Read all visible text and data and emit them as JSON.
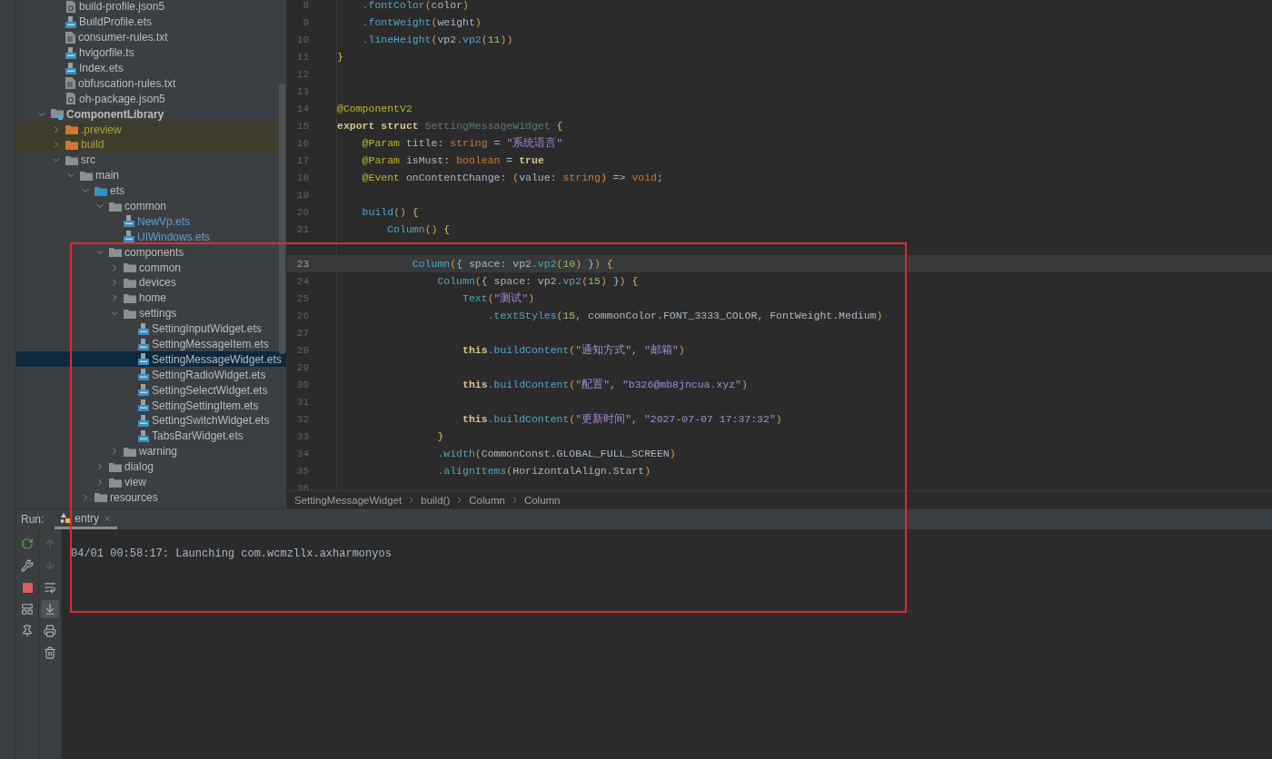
{
  "tree": [
    {
      "children": [
        {
          "name": "build-profile.json5",
          "kind": "json5",
          "selected": false,
          "excluded": false,
          "changed": false
        },
        {
          "name": "BuildProfile.ets",
          "kind": "ets",
          "selected": false,
          "excluded": false,
          "changed": false
        },
        {
          "name": "consumer-rules.txt",
          "kind": "txt",
          "selected": false,
          "excluded": false,
          "changed": false
        },
        {
          "name": "hvigorfile.ts",
          "kind": "ets",
          "selected": false,
          "excluded": false,
          "changed": false
        },
        {
          "name": "Index.ets",
          "kind": "ets",
          "selected": false,
          "excluded": false,
          "changed": false
        },
        {
          "name": "obfuscation-rules.txt",
          "kind": "txt",
          "selected": false,
          "excluded": false,
          "changed": false
        },
        {
          "name": "oh-package.json5",
          "kind": "json5",
          "selected": false,
          "excluded": false,
          "changed": false
        }
      ]
    },
    {
      "name": "ComponentLibrary",
      "kind": "module",
      "expanded": true,
      "selected": false,
      "excluded": false,
      "changed": false,
      "children": [
        {
          "name": ".preview",
          "kind": "folder",
          "expanded": false,
          "selected": false,
          "excluded": true,
          "changed": false
        },
        {
          "name": "build",
          "kind": "folder",
          "expanded": false,
          "selected": false,
          "excluded": true,
          "changed": false
        },
        {
          "name": "src",
          "kind": "folder",
          "expanded": true,
          "selected": false,
          "excluded": false,
          "changed": false,
          "children": [
            {
              "name": "main",
              "kind": "folder",
              "expanded": true,
              "selected": false,
              "excluded": false,
              "changed": false,
              "children": [
                {
                  "name": "ets",
                  "kind": "source",
                  "expanded": true,
                  "selected": false,
                  "excluded": false,
                  "changed": false,
                  "children": [
                    {
                      "name": "common",
                      "kind": "folder",
                      "expanded": true,
                      "selected": false,
                      "excluded": false,
                      "changed": false,
                      "children": [
                        {
                          "name": "NewVp.ets",
                          "kind": "ets",
                          "selected": false,
                          "excluded": false,
                          "changed": true
                        },
                        {
                          "name": "UIWindows.ets",
                          "kind": "ets",
                          "selected": false,
                          "excluded": false,
                          "changed": true
                        }
                      ]
                    },
                    {
                      "name": "components",
                      "kind": "folder",
                      "expanded": true,
                      "selected": false,
                      "excluded": false,
                      "changed": false,
                      "children": [
                        {
                          "name": "common",
                          "kind": "folder",
                          "expanded": false,
                          "selected": false,
                          "excluded": false,
                          "changed": false
                        },
                        {
                          "name": "devices",
                          "kind": "folder",
                          "expanded": false,
                          "selected": false,
                          "excluded": false,
                          "changed": false
                        },
                        {
                          "name": "home",
                          "kind": "folder",
                          "expanded": false,
                          "selected": false,
                          "excluded": false,
                          "changed": false
                        },
                        {
                          "name": "settings",
                          "kind": "folder",
                          "expanded": true,
                          "selected": false,
                          "excluded": false,
                          "changed": false,
                          "children": [
                            {
                              "name": "SettingInputWidget.ets",
                              "kind": "ets",
                              "selected": false,
                              "excluded": false,
                              "changed": false
                            },
                            {
                              "name": "SettingMessageItem.ets",
                              "kind": "ets",
                              "selected": false,
                              "excluded": false,
                              "changed": false
                            },
                            {
                              "name": "SettingMessageWidget.ets",
                              "kind": "ets",
                              "selected": true,
                              "excluded": false,
                              "changed": false
                            },
                            {
                              "name": "SettingRadioWidget.ets",
                              "kind": "ets",
                              "selected": false,
                              "excluded": false,
                              "changed": false
                            },
                            {
                              "name": "SettingSelectWidget.ets",
                              "kind": "ets",
                              "selected": false,
                              "excluded": false,
                              "changed": false
                            },
                            {
                              "name": "SettingSettingItem.ets",
                              "kind": "ets",
                              "selected": false,
                              "excluded": false,
                              "changed": false
                            },
                            {
                              "name": "SettingSwitchWidget.ets",
                              "kind": "ets",
                              "selected": false,
                              "excluded": false,
                              "changed": false
                            },
                            {
                              "name": "TabsBarWidget.ets",
                              "kind": "ets",
                              "selected": false,
                              "excluded": false,
                              "changed": false
                            }
                          ]
                        },
                        {
                          "name": "warning",
                          "kind": "folder",
                          "expanded": false,
                          "selected": false,
                          "excluded": false,
                          "changed": false
                        }
                      ]
                    },
                    {
                      "name": "dialog",
                      "kind": "folder",
                      "expanded": false,
                      "selected": false,
                      "excluded": false,
                      "changed": false
                    },
                    {
                      "name": "view",
                      "kind": "folder",
                      "expanded": false,
                      "selected": false,
                      "excluded": false,
                      "changed": false
                    }
                  ]
                },
                {
                  "name": "resources",
                  "kind": "folder",
                  "expanded": false,
                  "selected": false,
                  "excluded": false,
                  "changed": false
                }
              ]
            }
          ]
        }
      ]
    }
  ],
  "editor": {
    "lines": [
      {
        "number": "8",
        "selected": false,
        "tokens": [
          {
            "kind": "method",
            "text": "    .fontColor"
          },
          {
            "kind": "paren",
            "text": "("
          },
          {
            "kind": "plain",
            "text": "color"
          },
          {
            "kind": "paren",
            "text": ")"
          }
        ]
      },
      {
        "number": "9",
        "selected": false,
        "tokens": [
          {
            "kind": "method",
            "text": "    .fontWeight"
          },
          {
            "kind": "paren",
            "text": "("
          },
          {
            "kind": "plain",
            "text": "weight"
          },
          {
            "kind": "paren",
            "text": ")"
          }
        ]
      },
      {
        "number": "10",
        "selected": false,
        "tokens": [
          {
            "kind": "method",
            "text": "    .lineHeight"
          },
          {
            "kind": "paren",
            "text": "("
          },
          {
            "kind": "plain",
            "text": "vp2"
          },
          {
            "kind": "method",
            "text": ".vp2"
          },
          {
            "kind": "paren",
            "text": "("
          },
          {
            "kind": "number",
            "text": "11"
          },
          {
            "kind": "paren",
            "text": "))"
          }
        ]
      },
      {
        "number": "11",
        "selected": false,
        "tokens": [
          {
            "kind": "brace",
            "text": "}"
          }
        ]
      },
      {
        "number": "12",
        "selected": false
      },
      {
        "number": "13",
        "selected": false
      },
      {
        "number": "14",
        "selected": false,
        "tokens": [
          {
            "kind": "annotation",
            "text": "@ComponentV2"
          }
        ]
      },
      {
        "number": "15",
        "selected": false,
        "tokens": [
          {
            "kind": "keyword",
            "text": "export struct "
          },
          {
            "kind": "unused",
            "text": "SettingMessageWidget"
          },
          {
            "kind": "brace",
            "text": " {"
          }
        ]
      },
      {
        "number": "16",
        "selected": false,
        "tokens": [
          {
            "kind": "annotation",
            "text": "    @Param"
          },
          {
            "kind": "plain",
            "text": " title: "
          },
          {
            "kind": "type",
            "text": "string"
          },
          {
            "kind": "plain",
            "text": " = "
          },
          {
            "kind": "string",
            "text": "\"系统语言\""
          }
        ]
      },
      {
        "number": "17",
        "selected": false,
        "tokens": [
          {
            "kind": "annotation",
            "text": "    @Param"
          },
          {
            "kind": "plain",
            "text": " isMust: "
          },
          {
            "kind": "type",
            "text": "boolean"
          },
          {
            "kind": "plain",
            "text": " = "
          },
          {
            "kind": "keyword",
            "text": "true"
          }
        ]
      },
      {
        "number": "18",
        "selected": false,
        "tokens": [
          {
            "kind": "annotation",
            "text": "    @Event"
          },
          {
            "kind": "plain",
            "text": " onContentChange: "
          },
          {
            "kind": "paren",
            "text": "("
          },
          {
            "kind": "plain",
            "text": "value: "
          },
          {
            "kind": "type",
            "text": "string"
          },
          {
            "kind": "paren",
            "text": ")"
          },
          {
            "kind": "plain",
            "text": " => "
          },
          {
            "kind": "type",
            "text": "void"
          },
          {
            "kind": "plain",
            "text": ";"
          }
        ]
      },
      {
        "number": "19",
        "selected": false
      },
      {
        "number": "20",
        "selected": false,
        "tokens": [
          {
            "kind": "method",
            "text": "    build"
          },
          {
            "kind": "paren",
            "text": "()"
          },
          {
            "kind": "brace",
            "text": " {"
          }
        ]
      },
      {
        "number": "21",
        "selected": false,
        "tokens": [
          {
            "kind": "method",
            "text": "        Column"
          },
          {
            "kind": "paren",
            "text": "()"
          },
          {
            "kind": "brace",
            "text": " {"
          }
        ]
      },
      {
        "selected": false
      },
      {
        "number": "23",
        "selected": true,
        "tokens": [
          {
            "kind": "method",
            "text": "            Column"
          },
          {
            "kind": "paren",
            "text": "("
          },
          {
            "kind": "plain",
            "text": "{ space: vp2"
          },
          {
            "kind": "method",
            "text": ".vp2"
          },
          {
            "kind": "paren",
            "text": "("
          },
          {
            "kind": "number",
            "text": "10"
          },
          {
            "kind": "paren",
            "text": ")"
          },
          {
            "kind": "plain",
            "text": " }"
          },
          {
            "kind": "paren",
            "text": ")"
          },
          {
            "kind": "brace",
            "text": " {"
          }
        ]
      },
      {
        "number": "24",
        "selected": false,
        "tokens": [
          {
            "kind": "method",
            "text": "                Column"
          },
          {
            "kind": "paren",
            "text": "("
          },
          {
            "kind": "plain",
            "text": "{ space: vp2"
          },
          {
            "kind": "method",
            "text": ".vp2"
          },
          {
            "kind": "paren",
            "text": "("
          },
          {
            "kind": "number",
            "text": "15"
          },
          {
            "kind": "paren",
            "text": ")"
          },
          {
            "kind": "plain",
            "text": " }"
          },
          {
            "kind": "paren",
            "text": ")"
          },
          {
            "kind": "brace",
            "text": " {"
          }
        ]
      },
      {
        "number": "25",
        "selected": false,
        "tokens": [
          {
            "kind": "method",
            "text": "                    Text"
          },
          {
            "kind": "paren",
            "text": "("
          },
          {
            "kind": "string",
            "text": "\"测试\""
          },
          {
            "kind": "paren",
            "text": ")"
          }
        ]
      },
      {
        "number": "26",
        "selected": false,
        "tokens": [
          {
            "kind": "method",
            "text": "                        .textStyles"
          },
          {
            "kind": "paren",
            "text": "("
          },
          {
            "kind": "number",
            "text": "15"
          },
          {
            "kind": "plain",
            "text": ", commonColor.FONT_3333_COLOR, FontWeight.Medium"
          },
          {
            "kind": "paren",
            "text": ")"
          }
        ]
      },
      {
        "number": "27",
        "selected": false
      },
      {
        "number": "28",
        "selected": false,
        "tokens": [
          {
            "kind": "keyword",
            "text": "                    this"
          },
          {
            "kind": "method",
            "text": ".buildContent"
          },
          {
            "kind": "paren",
            "text": "("
          },
          {
            "kind": "string",
            "text": "\"通知方式\""
          },
          {
            "kind": "plain",
            "text": ", "
          },
          {
            "kind": "string",
            "text": "\"邮箱\""
          },
          {
            "kind": "paren",
            "text": ")"
          }
        ]
      },
      {
        "number": "29",
        "selected": false
      },
      {
        "number": "30",
        "selected": false,
        "tokens": [
          {
            "kind": "keyword",
            "text": "                    this"
          },
          {
            "kind": "method",
            "text": ".buildContent"
          },
          {
            "kind": "paren",
            "text": "("
          },
          {
            "kind": "string",
            "text": "\"配置\""
          },
          {
            "kind": "plain",
            "text": ", "
          },
          {
            "kind": "string",
            "text": "\"b326@mb8jncua.xyz\""
          },
          {
            "kind": "paren",
            "text": ")"
          }
        ]
      },
      {
        "number": "31",
        "selected": false
      },
      {
        "number": "32",
        "selected": false,
        "tokens": [
          {
            "kind": "keyword",
            "text": "                    this"
          },
          {
            "kind": "method",
            "text": ".buildContent"
          },
          {
            "kind": "paren",
            "text": "("
          },
          {
            "kind": "string",
            "text": "\"更新时间\""
          },
          {
            "kind": "plain",
            "text": ", "
          },
          {
            "kind": "string",
            "text": "\"2027-07-07 17:37:32\""
          },
          {
            "kind": "paren",
            "text": ")"
          }
        ]
      },
      {
        "number": "33",
        "selected": false,
        "tokens": [
          {
            "kind": "brace",
            "text": "                }"
          }
        ]
      },
      {
        "number": "34",
        "selected": false,
        "tokens": [
          {
            "kind": "method",
            "text": "                .width"
          },
          {
            "kind": "paren",
            "text": "("
          },
          {
            "kind": "plain",
            "text": "CommonConst.GLOBAL_FULL_SCREEN"
          },
          {
            "kind": "paren",
            "text": ")"
          }
        ]
      },
      {
        "number": "35",
        "selected": false,
        "tokens": [
          {
            "kind": "method",
            "text": "                .alignItems"
          },
          {
            "kind": "paren",
            "text": "("
          },
          {
            "kind": "plain",
            "text": "HorizontalAlign.Start"
          },
          {
            "kind": "paren",
            "text": ")"
          }
        ]
      },
      {
        "number": "36",
        "selected": false
      }
    ],
    "breadcrumbs": [
      "SettingMessageWidget",
      "build()",
      "Column",
      "Column"
    ]
  },
  "run_panel": {
    "label": "Run:",
    "tab": {
      "label": "entry",
      "selected": true
    },
    "primary_tools": [
      {
        "kind": "rerun"
      },
      {
        "kind": "wrench"
      },
      {
        "kind": "stop"
      },
      {
        "kind": "layout"
      },
      {
        "kind": "pin"
      }
    ],
    "secondary_tools": [
      {
        "kind": "up",
        "disabled": true,
        "selected": false
      },
      {
        "kind": "down",
        "disabled": true,
        "selected": false
      },
      {
        "kind": "wrap",
        "disabled": false,
        "selected": false
      },
      {
        "kind": "scroll-end",
        "disabled": false,
        "selected": true
      },
      {
        "kind": "print",
        "disabled": false,
        "selected": false
      },
      {
        "kind": "trash",
        "disabled": false,
        "selected": false
      }
    ],
    "console": [
      "04/01 00:58:17: Launching com.wcmzllx.axharmonyos"
    ]
  },
  "annotation": {
    "kind": "rectangle"
  }
}
